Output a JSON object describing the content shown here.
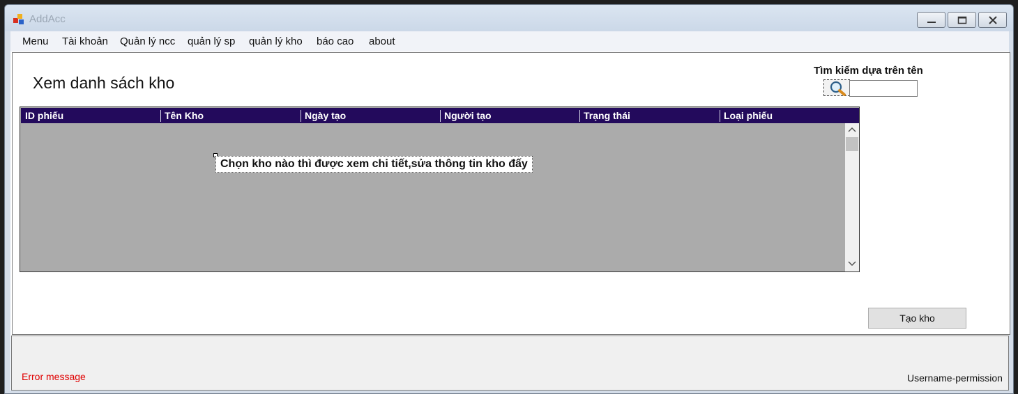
{
  "window": {
    "title": "AddAcc",
    "icon": "app-icon",
    "controls": [
      "minimize",
      "maximize",
      "close"
    ]
  },
  "menu": {
    "items": [
      "Menu",
      "Tài khoản",
      "Quản lý ncc",
      "quản lý sp",
      "quản lý kho",
      "báo cao",
      "about"
    ]
  },
  "main": {
    "title": "Xem danh sách kho",
    "search_label": "Tìm kiếm dựa trên tên",
    "search_value": "",
    "search_icon": "magnifier-icon",
    "grid": {
      "columns": [
        "ID phiếu",
        "Tên Kho",
        "Ngày tạo",
        "Người tạo",
        "Trạng thái",
        "Loại phiếu"
      ],
      "rows": [],
      "header_color": "#230a5c",
      "background_color": "#ababab"
    },
    "hint_label": "Chọn kho nào thì được xem chi tiết,sửa thông tin kho đấy",
    "create_button": "Tạo kho"
  },
  "status": {
    "error_message": "Error message",
    "error_color": "#e00000",
    "user_permission": "Username-permission"
  }
}
